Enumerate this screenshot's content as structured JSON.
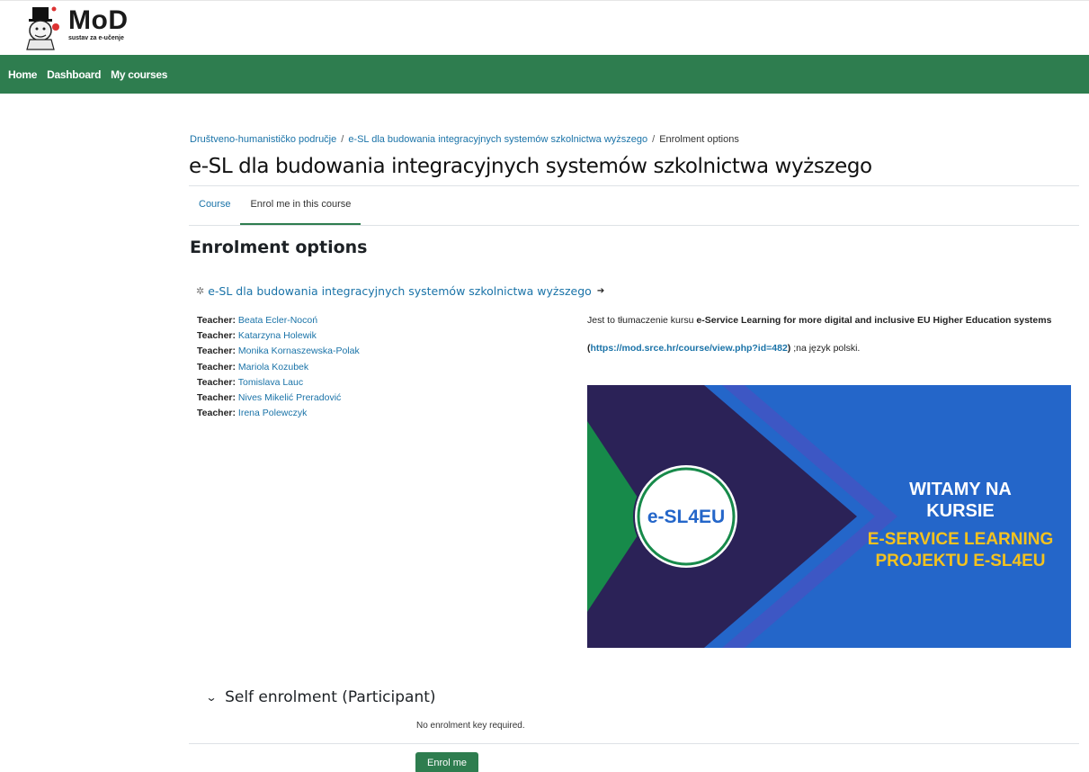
{
  "logo": {
    "main": "MoD",
    "sub": "sustav za e-učenje"
  },
  "nav": {
    "items": [
      "Home",
      "Dashboard",
      "My courses"
    ]
  },
  "breadcrumb": {
    "items": [
      "Društveno-humanističko područje",
      "e-SL dla budowania integracyjnych systemów szkolnictwa wyższego"
    ],
    "current": "Enrolment options"
  },
  "page_title": "e-SL dla budowania integracyjnych systemów szkolnictwa wyższego",
  "tabs": [
    {
      "label": "Course"
    },
    {
      "label": "Enrol me in this course",
      "active": true
    }
  ],
  "section_heading": "Enrolment options",
  "course_link": {
    "name": "e-SL dla budowania integracyjnych systemów szkolnictwa wyższego",
    "icon": "course-icon",
    "guest_icon": "login-icon"
  },
  "teachers": {
    "label": "Teacher:",
    "names": [
      "Beata Ecler-Nocoń",
      "Katarzyna Holewik",
      "Monika Kornaszewska-Polak",
      "Mariola Kozubek",
      "Tomislava Lauc",
      "Nives Mikelić Preradović",
      "Irena Polewczyk"
    ]
  },
  "summary": {
    "intro": "Jest to tłumaczenie kursu ",
    "course_bold": "e-Service Learning for more digital and inclusive EU Higher Education systems",
    "paren_open": "(",
    "url": "https://mod.srce.hr/course/view.php?id=482",
    "paren_close": ")",
    "tail": " ;na język polski."
  },
  "banner": {
    "logo_text": "e-SL4EU",
    "line1": "WITAMY NA",
    "line2": "KURSIE",
    "line3": "E-SERVICE LEARNING",
    "line4": "PROJEKTU E-SL4EU"
  },
  "self_enrolment": {
    "title": "Self enrolment (Participant)",
    "no_key": "No enrolment key required.",
    "button": "Enrol me"
  },
  "colors": {
    "brand_green": "#2e7d4f",
    "link_blue": "#1a73a8",
    "banner_blue": "#2466c9",
    "banner_navy": "#2b2257",
    "banner_yellow": "#f4c21f"
  }
}
